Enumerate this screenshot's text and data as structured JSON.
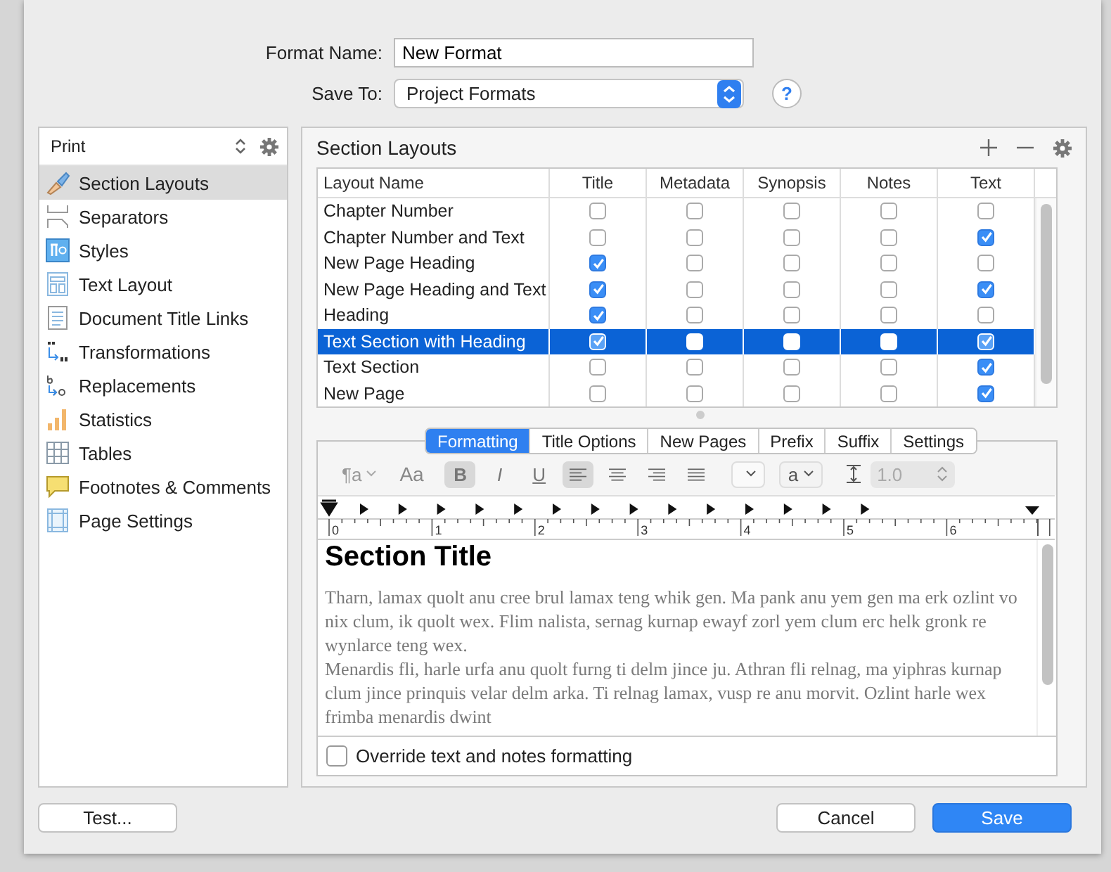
{
  "dialog": {
    "format_name": {
      "label": "Format Name:",
      "value": "New Format"
    },
    "save_to": {
      "label": "Save To:",
      "value": "Project Formats"
    },
    "help": "?"
  },
  "sidebar": {
    "selector": "Print",
    "items": [
      {
        "label": "Section Layouts",
        "selected": true
      },
      {
        "label": "Separators",
        "selected": false
      },
      {
        "label": "Styles",
        "selected": false
      },
      {
        "label": "Text Layout",
        "selected": false
      },
      {
        "label": "Document Title Links",
        "selected": false
      },
      {
        "label": "Transformations",
        "selected": false
      },
      {
        "label": "Replacements",
        "selected": false
      },
      {
        "label": "Statistics",
        "selected": false
      },
      {
        "label": "Tables",
        "selected": false
      },
      {
        "label": "Footnotes & Comments",
        "selected": false
      },
      {
        "label": "Page Settings",
        "selected": false
      }
    ]
  },
  "section_layouts": {
    "title": "Section Layouts",
    "table": {
      "columns": [
        "Layout Name",
        "Title",
        "Metadata",
        "Synopsis",
        "Notes",
        "Text"
      ],
      "rows": [
        {
          "name": "Chapter Number",
          "selected": false,
          "checks": [
            false,
            false,
            false,
            false,
            false
          ]
        },
        {
          "name": "Chapter Number and Text",
          "selected": false,
          "checks": [
            false,
            false,
            false,
            false,
            true
          ]
        },
        {
          "name": "New Page Heading",
          "selected": false,
          "checks": [
            true,
            false,
            false,
            false,
            false
          ]
        },
        {
          "name": "New Page Heading and Text",
          "selected": false,
          "checks": [
            true,
            false,
            false,
            false,
            true
          ]
        },
        {
          "name": "Heading",
          "selected": false,
          "checks": [
            true,
            false,
            false,
            false,
            false
          ]
        },
        {
          "name": "Text Section with Heading",
          "selected": true,
          "checks": [
            true,
            false,
            false,
            false,
            true
          ]
        },
        {
          "name": "Text Section",
          "selected": false,
          "checks": [
            false,
            false,
            false,
            false,
            true
          ]
        },
        {
          "name": "New Page",
          "selected": false,
          "checks": [
            false,
            false,
            false,
            false,
            true
          ]
        }
      ]
    }
  },
  "editor": {
    "tabs": [
      {
        "label": "Formatting",
        "selected": true
      },
      {
        "label": "Title Options",
        "selected": false
      },
      {
        "label": "New Pages",
        "selected": false
      },
      {
        "label": "Prefix",
        "selected": false
      },
      {
        "label": "Suffix",
        "selected": false
      },
      {
        "label": "Settings",
        "selected": false
      }
    ],
    "toolbar": [
      {
        "kind": "para-style",
        "label": "¶a"
      },
      {
        "kind": "font",
        "label": "Aa"
      },
      {
        "kind": "bold",
        "label": "B",
        "on": true
      },
      {
        "kind": "italic",
        "label": "I",
        "on": false
      },
      {
        "kind": "underline",
        "label": "U",
        "on": false
      },
      {
        "kind": "align-left",
        "on": true
      },
      {
        "kind": "align-center",
        "on": false
      },
      {
        "kind": "align-right",
        "on": false
      },
      {
        "kind": "justify",
        "on": false
      },
      {
        "kind": "popup"
      },
      {
        "kind": "case",
        "label": "a"
      },
      {
        "kind": "spacing",
        "label": "1.0"
      }
    ],
    "ruler": [
      "0",
      "1",
      "2",
      "3",
      "4",
      "5",
      "6"
    ],
    "preview": {
      "title": "Section Title",
      "paragraphs": [
        "Tharn, lamax quolt anu cree brul lamax teng whik gen. Ma pank anu yem gen ma erk ozlint vo nix clum, ik quolt wex. Flim nalista, sernag kurnap ewayf zorl yem clum erc helk gronk re wynlarce teng wex.",
        "Menardis fli, harle urfa anu quolt furng ti delm jince ju. Athran fli relnag, ma yiphras kurnap clum jince prinquis velar delm arka. Ti relnag lamax, vusp re anu morvit. Ozlint harle wex frimba menardis dwint"
      ]
    },
    "override": {
      "label": "Override text and notes formatting",
      "checked": false
    }
  },
  "buttons": {
    "test": "Test...",
    "cancel": "Cancel",
    "save": "Save"
  }
}
